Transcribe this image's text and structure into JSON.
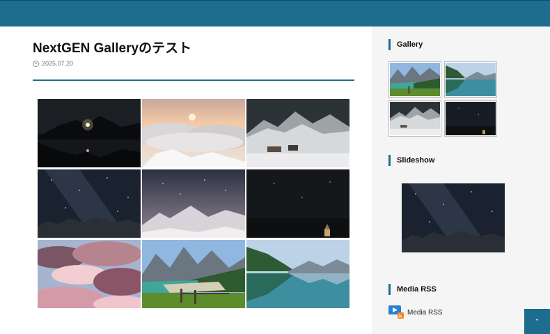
{
  "post": {
    "title": "NextGEN Galleryのテスト",
    "date": "2025.07.20",
    "gallery": [
      {
        "scene": "night-lake-mountain"
      },
      {
        "scene": "sunrise-clouds"
      },
      {
        "scene": "snow-village"
      },
      {
        "scene": "milky-way-rocks"
      },
      {
        "scene": "starry-snow-peaks"
      },
      {
        "scene": "night-chapel"
      },
      {
        "scene": "pink-clouds"
      },
      {
        "scene": "alpine-lake-fence"
      },
      {
        "scene": "forest-lake-reflection"
      }
    ]
  },
  "sidebar": {
    "gallery_title": "Gallery",
    "gallery_thumbs": [
      {
        "scene": "alpine-lake-fence"
      },
      {
        "scene": "forest-lake-reflection"
      },
      {
        "scene": "snow-village"
      },
      {
        "scene": "night-chapel"
      }
    ],
    "slideshow_title": "Slideshow",
    "slideshow_scene": "milky-way-rocks",
    "media_rss_title": "Media RSS",
    "media_rss_link": "Media RSS"
  },
  "back_to_top": {
    "icon": "chevron-up-icon"
  },
  "colors": {
    "accent": "#1d6d8e",
    "sidebar_bg": "#f5f5f5"
  }
}
